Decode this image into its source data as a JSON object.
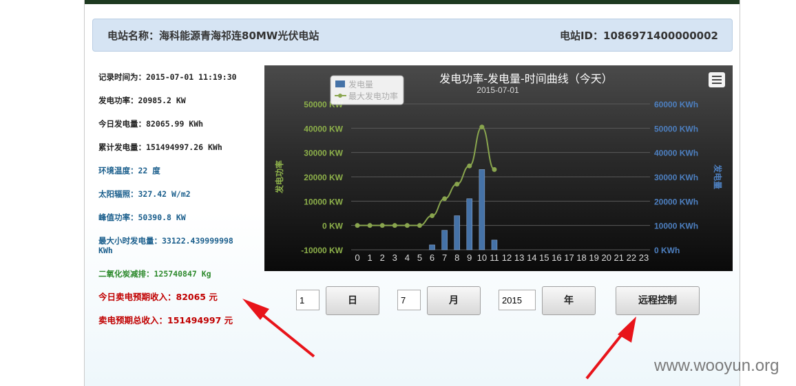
{
  "header": {
    "station_name": "电站名称：海科能源青海祁连80MW光伏电站",
    "station_id": "电站ID：1086971400000002"
  },
  "info": {
    "record_time": "记录时间为：2015-07-01 11:19:30",
    "power": "发电功率：20985.2 KW",
    "today_gen": "今日发电量：82065.99 KWh",
    "total_gen": "累计发电量：151494997.26 KWh",
    "env_temp": "环境温度：22 度",
    "irradiance": "太阳辐照：327.42 W/m2",
    "peak_power": "峰值功率：50390.8 KW",
    "max_hour_gen": "最大小时发电量：33122.439999998 KWh",
    "co2": "二氧化炭减排：125740847 Kg",
    "today_income": "今日卖电预期收入：82065 元",
    "total_income": "卖电预期总收入：151494997 元"
  },
  "chart_data": {
    "type": "bar",
    "title": "发电功率-发电量-时间曲线（今天）",
    "subtitle": "2015-07-01",
    "categories": [
      "0",
      "1",
      "2",
      "3",
      "4",
      "5",
      "6",
      "7",
      "8",
      "9",
      "10",
      "11",
      "12",
      "13",
      "14",
      "15",
      "16",
      "17",
      "18",
      "19",
      "20",
      "21",
      "22",
      "23"
    ],
    "left_axis": {
      "label": "发电功率",
      "ticks": [
        "50000 KW",
        "40000 KW",
        "30000 KW",
        "20000 KW",
        "10000 KW",
        "0 KW",
        "-10000 KW"
      ],
      "range": [
        -10000,
        50000
      ]
    },
    "right_axis": {
      "label": "发电量",
      "ticks": [
        "60000 KWh",
        "50000 KWh",
        "40000 KWh",
        "30000 KWh",
        "20000 KWh",
        "10000 KWh",
        "0 KWh"
      ],
      "range": [
        0,
        60000
      ]
    },
    "series": [
      {
        "name": "发电量",
        "type": "bar",
        "axis": "right",
        "color": "#4572a7",
        "values": [
          0,
          0,
          0,
          0,
          0,
          0,
          2000,
          8000,
          14000,
          21000,
          33000,
          4000,
          null,
          null,
          null,
          null,
          null,
          null,
          null,
          null,
          null,
          null,
          null,
          null
        ]
      },
      {
        "name": "最大发电功率",
        "type": "line",
        "axis": "left",
        "color": "#89a54e",
        "values": [
          0,
          0,
          0,
          0,
          0,
          0,
          4000,
          11000,
          17000,
          24500,
          40500,
          23000,
          null,
          null,
          null,
          null,
          null,
          null,
          null,
          null,
          null,
          null,
          null,
          null
        ]
      }
    ],
    "legend": "top-left",
    "grid": true
  },
  "controls": {
    "day_value": "1",
    "day_label": "日",
    "month_value": "7",
    "month_label": "月",
    "year_value": "2015",
    "year_label": "年",
    "remote_label": "远程控制"
  },
  "watermark": "www.wooyun.org",
  "colors": {
    "header_bg": "#d6e4f3",
    "red_text": "#c00000",
    "blue_text": "#1a5e8c",
    "green_text": "#2e8a2e",
    "arrow": "#e8141a"
  }
}
